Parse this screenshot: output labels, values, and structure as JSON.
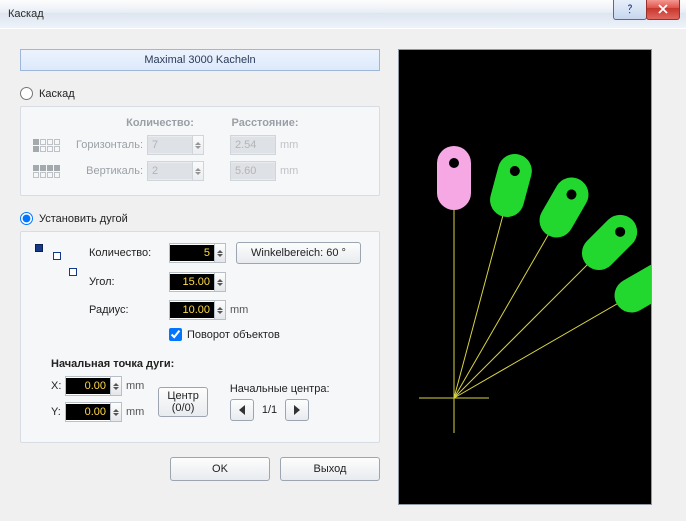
{
  "window": {
    "title": "Каскад"
  },
  "banner": "Maximal 3000 Kacheln",
  "modes": {
    "cascade_label": "Каскад",
    "arc_label": "Установить дугой",
    "selected": "arc"
  },
  "cascade": {
    "headers": {
      "qty": "Количество:",
      "dist": "Расстояние:"
    },
    "rows": {
      "horiz": {
        "label": "Горизонталь:",
        "qty": "7",
        "dist": "2.54",
        "unit": "mm"
      },
      "vert": {
        "label": "Вертикаль:",
        "qty": "2",
        "dist": "5.60",
        "unit": "mm"
      }
    }
  },
  "arc": {
    "qty_label": "Количество:",
    "qty": "5",
    "range_button": "Winkelbereich: 60 °",
    "angle_label": "Угол:",
    "angle": "15.00",
    "angle_unit": "",
    "radius_label": "Радиус:",
    "radius": "10.00",
    "radius_unit": "mm",
    "rotate_label": "Поворот объектов",
    "rotate_checked": true,
    "start": {
      "header": "Начальная точка дуги:",
      "x_label": "X:",
      "x": "0.00",
      "x_unit": "mm",
      "y_label": "Y:",
      "y": "0.00",
      "y_unit": "mm",
      "center_button_line1": "Центр",
      "center_button_line2": "(0/0)",
      "origins_label": "Начальные центра:",
      "origins_index": "1/1"
    }
  },
  "buttons": {
    "ok": "OK",
    "exit": "Выход"
  },
  "icons": {
    "help": "help-icon",
    "close": "close-icon",
    "spinner": "spinner-icon",
    "prev": "triangle-left-icon",
    "next": "triangle-right-icon"
  },
  "chart_data": {
    "type": "diagram",
    "description": "Arc-array preview: 5 pill shapes fanned over 60° from a common pivot",
    "count": 5,
    "angle_step_deg": 15,
    "total_range_deg": 60,
    "start_angle_deg_from_vertical": 0,
    "radius_mm": 10.0,
    "pivot": {
      "x_mm": 0.0,
      "y_mm": 0.0
    },
    "rotate_objects": true,
    "series": [
      {
        "index": 0,
        "angle_deg": 0,
        "color": "#f5a8e4",
        "is_original": true
      },
      {
        "index": 1,
        "angle_deg": 15,
        "color": "#22d82f",
        "is_original": false
      },
      {
        "index": 2,
        "angle_deg": 30,
        "color": "#22d82f",
        "is_original": false
      },
      {
        "index": 3,
        "angle_deg": 45,
        "color": "#22d82f",
        "is_original": false
      },
      {
        "index": 4,
        "angle_deg": 60,
        "color": "#22d82f",
        "is_original": false
      }
    ]
  }
}
